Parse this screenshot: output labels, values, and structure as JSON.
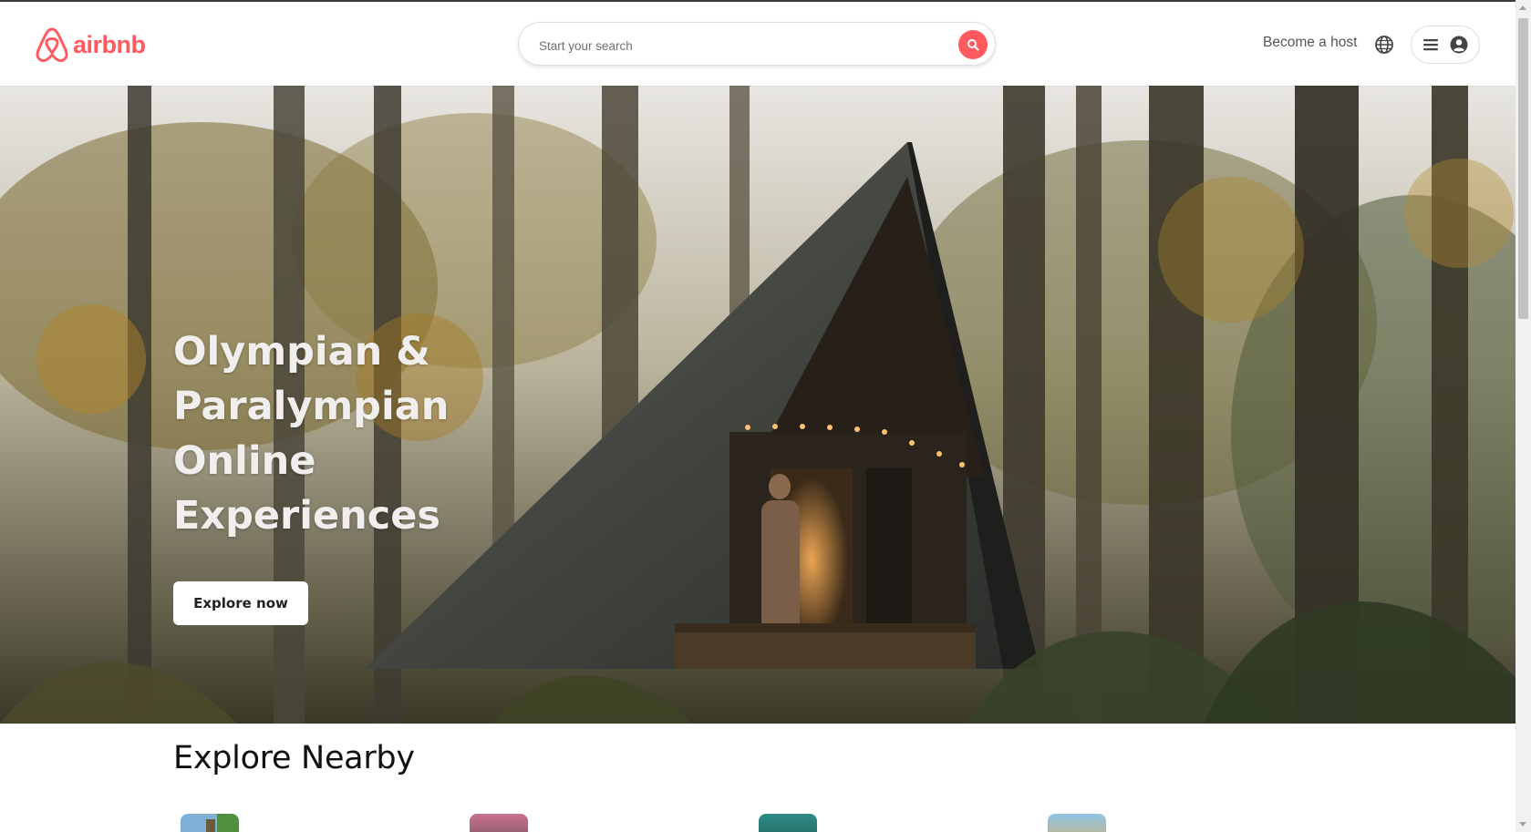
{
  "header": {
    "logo_text": "airbnb",
    "brand_color": "#ff5a5f",
    "search": {
      "placeholder": "Start your search",
      "button_icon": "search-icon"
    },
    "host_link": "Become a host",
    "globe_icon": "globe-icon",
    "menu_icon": "hamburger-menu-icon",
    "avatar_icon": "user-avatar-icon"
  },
  "hero": {
    "title": "Olympian & Paralympian Online Experiences",
    "cta_label": "Explore now"
  },
  "explore": {
    "title": "Explore Nearby",
    "cards": [
      {
        "thumb_color": "#7fb0d8"
      },
      {
        "thumb_color": "#c9728f"
      },
      {
        "thumb_color": "#2f8d86"
      },
      {
        "thumb_color": "#8fc3e6"
      }
    ]
  }
}
